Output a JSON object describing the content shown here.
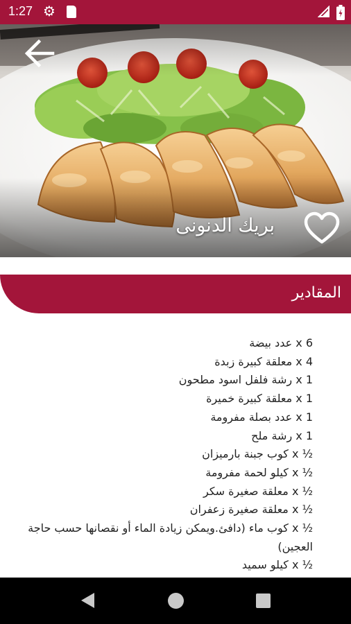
{
  "status_bar": {
    "time": "1:27",
    "icons": [
      "gear-icon",
      "sd-card-icon",
      "signal-icon",
      "battery-icon"
    ]
  },
  "recipe": {
    "title": "بريك الدنونى",
    "back_icon": "arrow-left-icon",
    "favorite_icon": "heart-outline-icon",
    "favorited": false
  },
  "ingredients_section": {
    "title": "المقادير",
    "items": [
      "6 x عدد بيضة",
      "4 x معلقة كبيرة زبدة",
      "1 x رشة فلفل اسود مطحون",
      "1 x معلقة كبيرة خميرة",
      "1 x عدد بصلة مفرومة",
      "1 x رشة ملح",
      "½ x كوب جبنة بارميزان",
      "½ x كيلو لحمة مفرومة",
      "½ x معلقة صغيرة سكر",
      "½ x معلقة صغيرة زعفران",
      "½ x كوب ماء (دافئ.ويمكن زيادة الماء أو نقصانها حسب حاجة العجين)",
      "½ x كيلو سميد"
    ]
  },
  "nav_bar": {
    "buttons": [
      "back-triangle-icon",
      "home-circle-icon",
      "recents-square-icon"
    ]
  },
  "colors": {
    "brand": "#a3153a",
    "text": "#222222",
    "nav_background": "#000000"
  }
}
